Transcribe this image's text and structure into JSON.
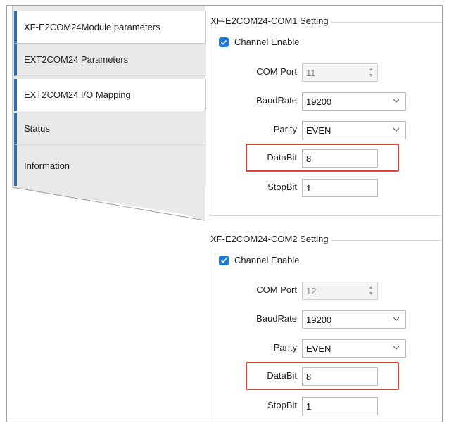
{
  "nav": {
    "items": [
      {
        "label": "XF-E2COM24Module parameters"
      },
      {
        "label": "EXT2COM24 Parameters"
      },
      {
        "label": "EXT2COM24 I/O Mapping"
      },
      {
        "label": "Status"
      },
      {
        "label": "Information"
      }
    ]
  },
  "com1": {
    "title": "XF-E2COM24-COM1 Setting",
    "channel_enable": "Channel Enable",
    "com_port_label": "COM Port",
    "com_port_value": "11",
    "baudrate_label": "BaudRate",
    "baudrate_value": "19200",
    "parity_label": "Parity",
    "parity_value": "EVEN",
    "databit_label": "DataBit",
    "databit_value": "8",
    "stopbit_label": "StopBit",
    "stopbit_value": "1"
  },
  "com2": {
    "title": "XF-E2COM24-COM2 Setting",
    "channel_enable": "Channel Enable",
    "com_port_label": "COM Port",
    "com_port_value": "12",
    "baudrate_label": "BaudRate",
    "baudrate_value": "19200",
    "parity_label": "Parity",
    "parity_value": "EVEN",
    "databit_label": "DataBit",
    "databit_value": "8",
    "stopbit_label": "StopBit",
    "stopbit_value": "1"
  },
  "colors": {
    "accent": "#1f78d1",
    "highlight": "#d9483b",
    "nav_active_bar": "#2b6cb0"
  }
}
